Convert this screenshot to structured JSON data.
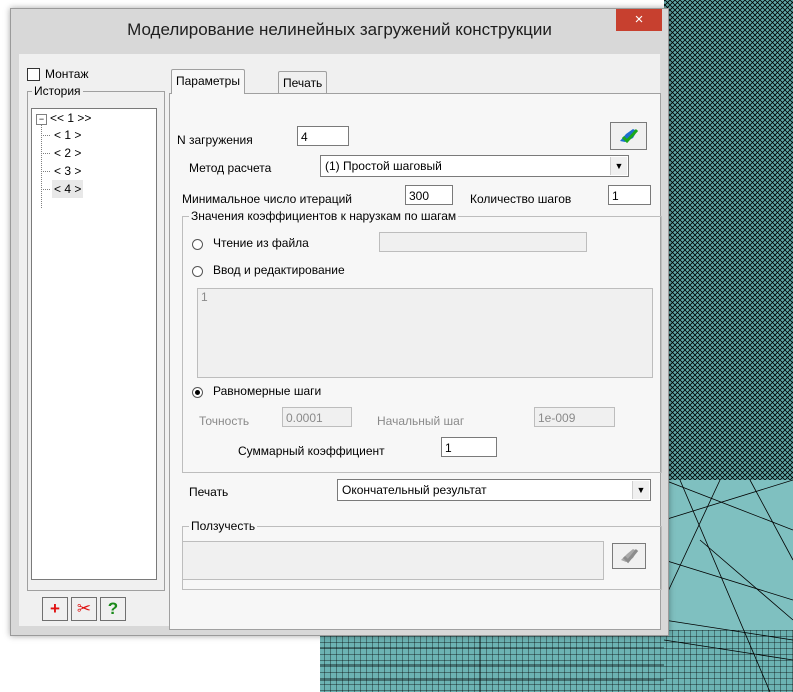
{
  "window": {
    "title": "Моделирование нелинейных загружений конструкции",
    "close_glyph": "×"
  },
  "left": {
    "montazh_label": "Монтаж",
    "history_label": "История",
    "tree": {
      "root_toggle": "−",
      "root": "<< 1 >>",
      "children": [
        "< 1 >",
        "< 2 >",
        "< 3 >",
        "< 4 >"
      ],
      "selected_index": 3
    },
    "buttons": {
      "add_icon": "plus-icon",
      "delete_icon": "scissors-icon",
      "help_icon": "question-icon",
      "add_glyph": "+",
      "delete_glyph": "✂",
      "help_glyph": "?"
    }
  },
  "tabs": [
    "Параметры",
    "Печать"
  ],
  "params": {
    "n_label": "N загружения",
    "n_value": "4",
    "method_label": "Метод расчета",
    "method_value": "(1) Простой шаговый",
    "min_iter_label": "Минимальное число итераций",
    "min_iter_value": "300",
    "steps_label": "Количество шагов",
    "steps_value": "1",
    "group_label": "Значения коэффициентов к нарузкам по шагам",
    "radio_file": "Чтение из файла",
    "file_value": "",
    "radio_edit": "Ввод и редактирование",
    "edit_value": "1",
    "radio_uniform": "Равномерные шаги",
    "accuracy_label": "Точность",
    "accuracy_value": "0.0001",
    "start_step_label": "Начальный   шаг",
    "start_step_value": "1e-009",
    "total_coef_label": "Суммарный коэффициент",
    "total_coef_value": "1",
    "print_label": "Печать",
    "print_value": "Окончательный результат",
    "creep_label": "Ползучесть",
    "creep_value": ""
  },
  "colors": {
    "mesh_fill": "#5fa8a8",
    "mesh_line": "#000000",
    "close_bg": "#c7402f",
    "add_red": "#e01010",
    "help_green": "#1a8a1a"
  }
}
